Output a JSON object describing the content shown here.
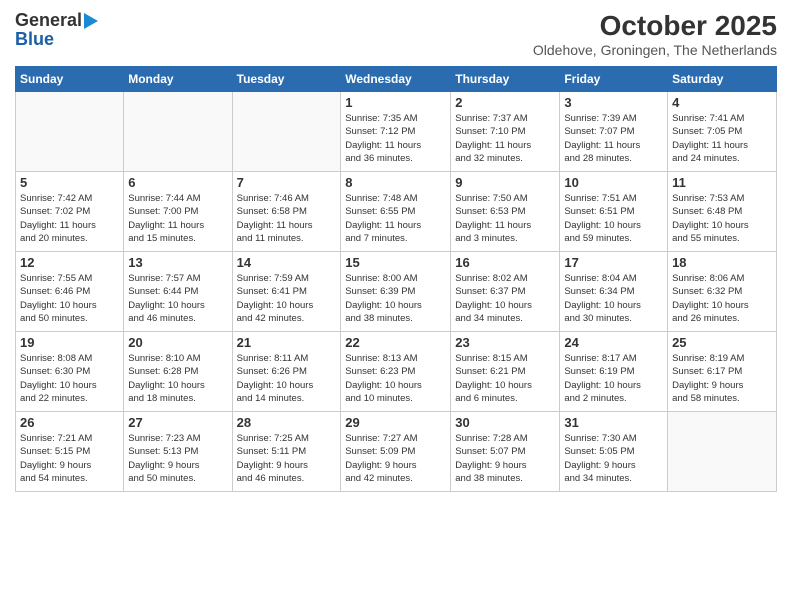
{
  "logo": {
    "line1": "General",
    "line2": "Blue"
  },
  "title": "October 2025",
  "location": "Oldehove, Groningen, The Netherlands",
  "days_of_week": [
    "Sunday",
    "Monday",
    "Tuesday",
    "Wednesday",
    "Thursday",
    "Friday",
    "Saturday"
  ],
  "weeks": [
    [
      {
        "day": "",
        "info": ""
      },
      {
        "day": "",
        "info": ""
      },
      {
        "day": "",
        "info": ""
      },
      {
        "day": "1",
        "info": "Sunrise: 7:35 AM\nSunset: 7:12 PM\nDaylight: 11 hours\nand 36 minutes."
      },
      {
        "day": "2",
        "info": "Sunrise: 7:37 AM\nSunset: 7:10 PM\nDaylight: 11 hours\nand 32 minutes."
      },
      {
        "day": "3",
        "info": "Sunrise: 7:39 AM\nSunset: 7:07 PM\nDaylight: 11 hours\nand 28 minutes."
      },
      {
        "day": "4",
        "info": "Sunrise: 7:41 AM\nSunset: 7:05 PM\nDaylight: 11 hours\nand 24 minutes."
      }
    ],
    [
      {
        "day": "5",
        "info": "Sunrise: 7:42 AM\nSunset: 7:02 PM\nDaylight: 11 hours\nand 20 minutes."
      },
      {
        "day": "6",
        "info": "Sunrise: 7:44 AM\nSunset: 7:00 PM\nDaylight: 11 hours\nand 15 minutes."
      },
      {
        "day": "7",
        "info": "Sunrise: 7:46 AM\nSunset: 6:58 PM\nDaylight: 11 hours\nand 11 minutes."
      },
      {
        "day": "8",
        "info": "Sunrise: 7:48 AM\nSunset: 6:55 PM\nDaylight: 11 hours\nand 7 minutes."
      },
      {
        "day": "9",
        "info": "Sunrise: 7:50 AM\nSunset: 6:53 PM\nDaylight: 11 hours\nand 3 minutes."
      },
      {
        "day": "10",
        "info": "Sunrise: 7:51 AM\nSunset: 6:51 PM\nDaylight: 10 hours\nand 59 minutes."
      },
      {
        "day": "11",
        "info": "Sunrise: 7:53 AM\nSunset: 6:48 PM\nDaylight: 10 hours\nand 55 minutes."
      }
    ],
    [
      {
        "day": "12",
        "info": "Sunrise: 7:55 AM\nSunset: 6:46 PM\nDaylight: 10 hours\nand 50 minutes."
      },
      {
        "day": "13",
        "info": "Sunrise: 7:57 AM\nSunset: 6:44 PM\nDaylight: 10 hours\nand 46 minutes."
      },
      {
        "day": "14",
        "info": "Sunrise: 7:59 AM\nSunset: 6:41 PM\nDaylight: 10 hours\nand 42 minutes."
      },
      {
        "day": "15",
        "info": "Sunrise: 8:00 AM\nSunset: 6:39 PM\nDaylight: 10 hours\nand 38 minutes."
      },
      {
        "day": "16",
        "info": "Sunrise: 8:02 AM\nSunset: 6:37 PM\nDaylight: 10 hours\nand 34 minutes."
      },
      {
        "day": "17",
        "info": "Sunrise: 8:04 AM\nSunset: 6:34 PM\nDaylight: 10 hours\nand 30 minutes."
      },
      {
        "day": "18",
        "info": "Sunrise: 8:06 AM\nSunset: 6:32 PM\nDaylight: 10 hours\nand 26 minutes."
      }
    ],
    [
      {
        "day": "19",
        "info": "Sunrise: 8:08 AM\nSunset: 6:30 PM\nDaylight: 10 hours\nand 22 minutes."
      },
      {
        "day": "20",
        "info": "Sunrise: 8:10 AM\nSunset: 6:28 PM\nDaylight: 10 hours\nand 18 minutes."
      },
      {
        "day": "21",
        "info": "Sunrise: 8:11 AM\nSunset: 6:26 PM\nDaylight: 10 hours\nand 14 minutes."
      },
      {
        "day": "22",
        "info": "Sunrise: 8:13 AM\nSunset: 6:23 PM\nDaylight: 10 hours\nand 10 minutes."
      },
      {
        "day": "23",
        "info": "Sunrise: 8:15 AM\nSunset: 6:21 PM\nDaylight: 10 hours\nand 6 minutes."
      },
      {
        "day": "24",
        "info": "Sunrise: 8:17 AM\nSunset: 6:19 PM\nDaylight: 10 hours\nand 2 minutes."
      },
      {
        "day": "25",
        "info": "Sunrise: 8:19 AM\nSunset: 6:17 PM\nDaylight: 9 hours\nand 58 minutes."
      }
    ],
    [
      {
        "day": "26",
        "info": "Sunrise: 7:21 AM\nSunset: 5:15 PM\nDaylight: 9 hours\nand 54 minutes."
      },
      {
        "day": "27",
        "info": "Sunrise: 7:23 AM\nSunset: 5:13 PM\nDaylight: 9 hours\nand 50 minutes."
      },
      {
        "day": "28",
        "info": "Sunrise: 7:25 AM\nSunset: 5:11 PM\nDaylight: 9 hours\nand 46 minutes."
      },
      {
        "day": "29",
        "info": "Sunrise: 7:27 AM\nSunset: 5:09 PM\nDaylight: 9 hours\nand 42 minutes."
      },
      {
        "day": "30",
        "info": "Sunrise: 7:28 AM\nSunset: 5:07 PM\nDaylight: 9 hours\nand 38 minutes."
      },
      {
        "day": "31",
        "info": "Sunrise: 7:30 AM\nSunset: 5:05 PM\nDaylight: 9 hours\nand 34 minutes."
      },
      {
        "day": "",
        "info": ""
      }
    ]
  ]
}
